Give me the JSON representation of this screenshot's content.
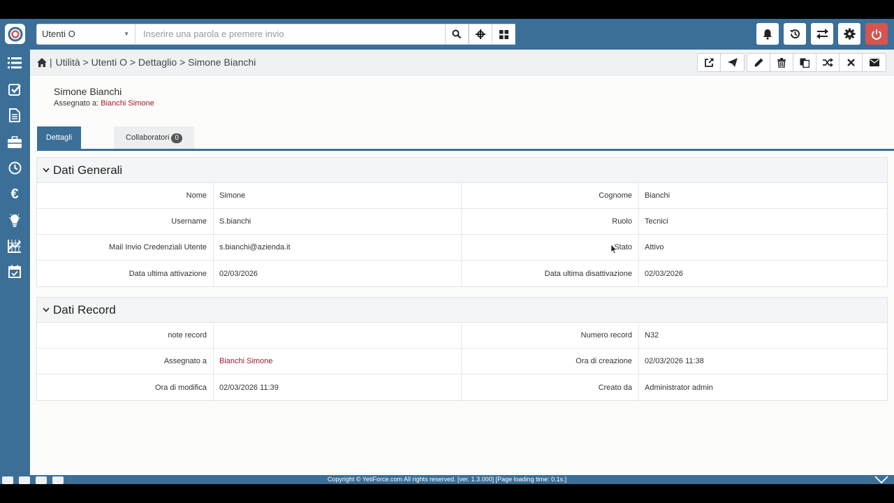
{
  "topbar": {
    "module_select": "Utenti O",
    "search_placeholder": "Inserire una parola e premere invio"
  },
  "breadcrumb": {
    "separator_home": "|",
    "path": "Utilità > Utenti O > Dettaglio > Simone Bianchi"
  },
  "record": {
    "title": "Simone Bianchi",
    "assigned_label": "Assegnato a:",
    "assigned_value": "Bianchi Simone"
  },
  "tabs": {
    "details": "Dettagli",
    "collaborators": "Collaboratori",
    "collaborators_count": "0"
  },
  "general": {
    "title": "Dati Generali",
    "rows": [
      {
        "l1": "Nome",
        "v1": "Simone",
        "l2": "Cognome",
        "v2": "Bianchi"
      },
      {
        "l1": "Username",
        "v1": "S.bianchi",
        "l2": "Ruolo",
        "v2": "Tecnici"
      },
      {
        "l1": "Mail Invio Credenziali Utente",
        "v1": "s.bianchi@azienda.it",
        "l2": "Stato",
        "v2": "Attivo"
      },
      {
        "l1": "Data ultima attivazione",
        "v1": "02/03/2026",
        "l2": "Data ultima disattivazione",
        "v2": "02/03/2026"
      }
    ]
  },
  "recorddata": {
    "title": "Dati Record",
    "rows": [
      {
        "l1": "note record",
        "v1": "",
        "l2": "Numero record",
        "v2": "N32"
      },
      {
        "l1": "Assegnato a",
        "v1": "Bianchi Simone",
        "l2": "Ora di creazione",
        "v2": "02/03/2026 11:38"
      },
      {
        "l1": "Ora di modifica",
        "v1": "02/03/2026 11:39",
        "l2": "Creato da",
        "v2": "Administrator admin"
      }
    ]
  },
  "footer": {
    "copyright": "Copyright © YetiForce.com All rights reserved. [ver. 1.3.000] [Page loading time: 0.1s.]"
  },
  "colors": {
    "brand": "#3b6f97",
    "link": "#a0192c",
    "danger": "#d9534f"
  }
}
